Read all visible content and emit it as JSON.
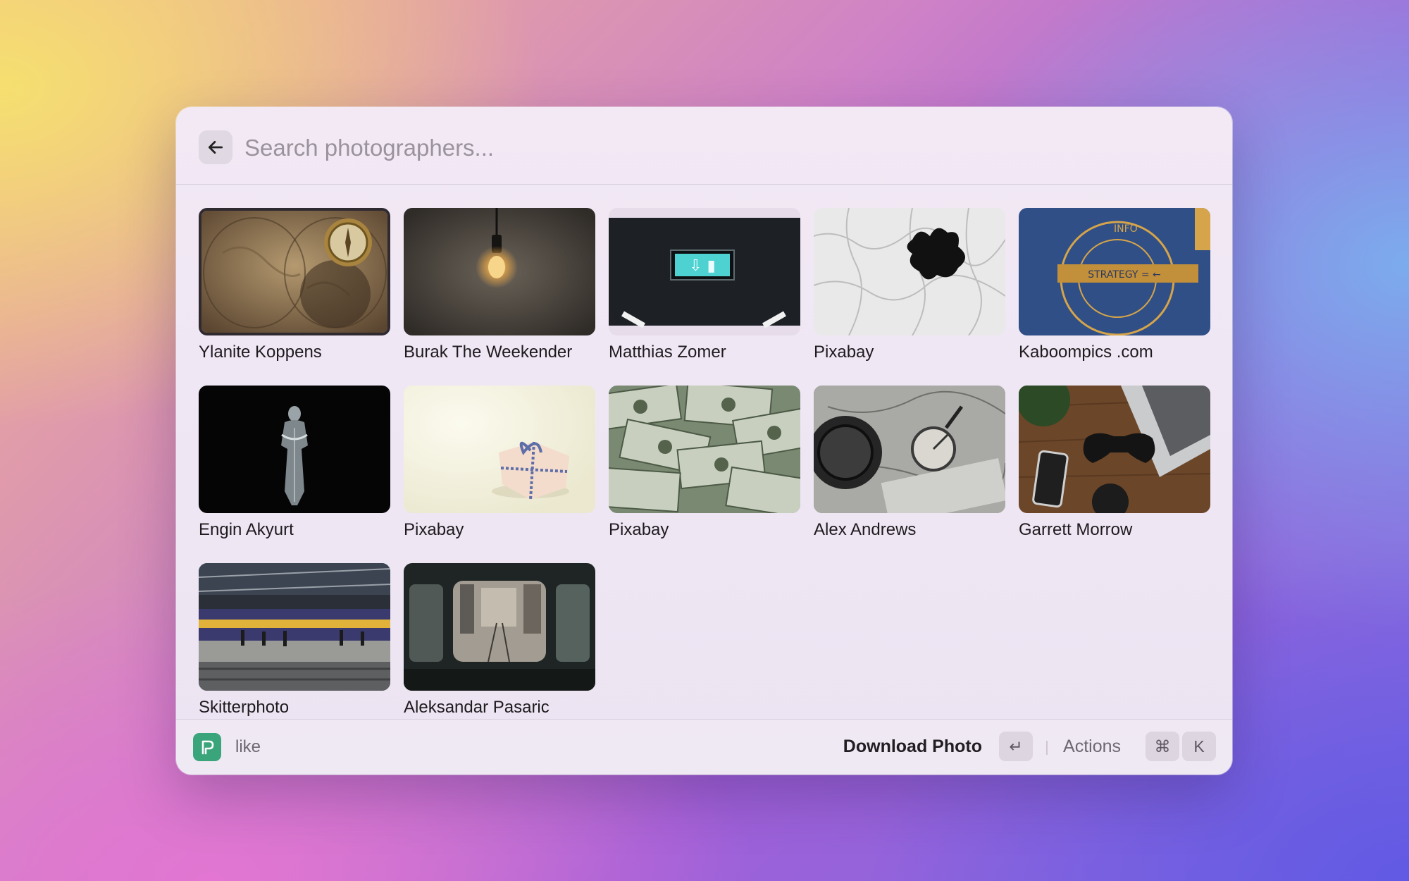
{
  "search": {
    "placeholder": "Search photographers...",
    "value": ""
  },
  "grid": {
    "selected_index": 0,
    "items": [
      {
        "name": "Ylanite Koppens",
        "icon": "vintage-map-compass-photo"
      },
      {
        "name": "Burak The Weekender",
        "icon": "light-bulb-photo"
      },
      {
        "name": "Matthias Zomer",
        "icon": "exit-sign-photo"
      },
      {
        "name": "Pixabay",
        "icon": "puzzle-piece-photo"
      },
      {
        "name": "Kaboompics .com",
        "icon": "strategy-drawing-photo"
      },
      {
        "name": "Engin Akyurt",
        "icon": "statuette-photo"
      },
      {
        "name": "Pixabay",
        "icon": "gift-box-photo"
      },
      {
        "name": "Pixabay",
        "icon": "dollar-bills-photo"
      },
      {
        "name": "Alex Andrews",
        "icon": "compass-map-photo"
      },
      {
        "name": "Garrett Morrow",
        "icon": "desk-gamepad-photo"
      },
      {
        "name": "Skitterphoto",
        "icon": "train-station-photo"
      },
      {
        "name": "Aleksandar Pasaric",
        "icon": "tram-window-city-photo"
      }
    ]
  },
  "footer": {
    "extension_name": "like",
    "primary_action": "Download Photo",
    "primary_key": "↵",
    "actions_label": "Actions",
    "actions_keys": [
      "⌘",
      "K"
    ]
  },
  "colors": {
    "app_icon": "#3aa57a",
    "selection_border": "#2f2a30"
  }
}
